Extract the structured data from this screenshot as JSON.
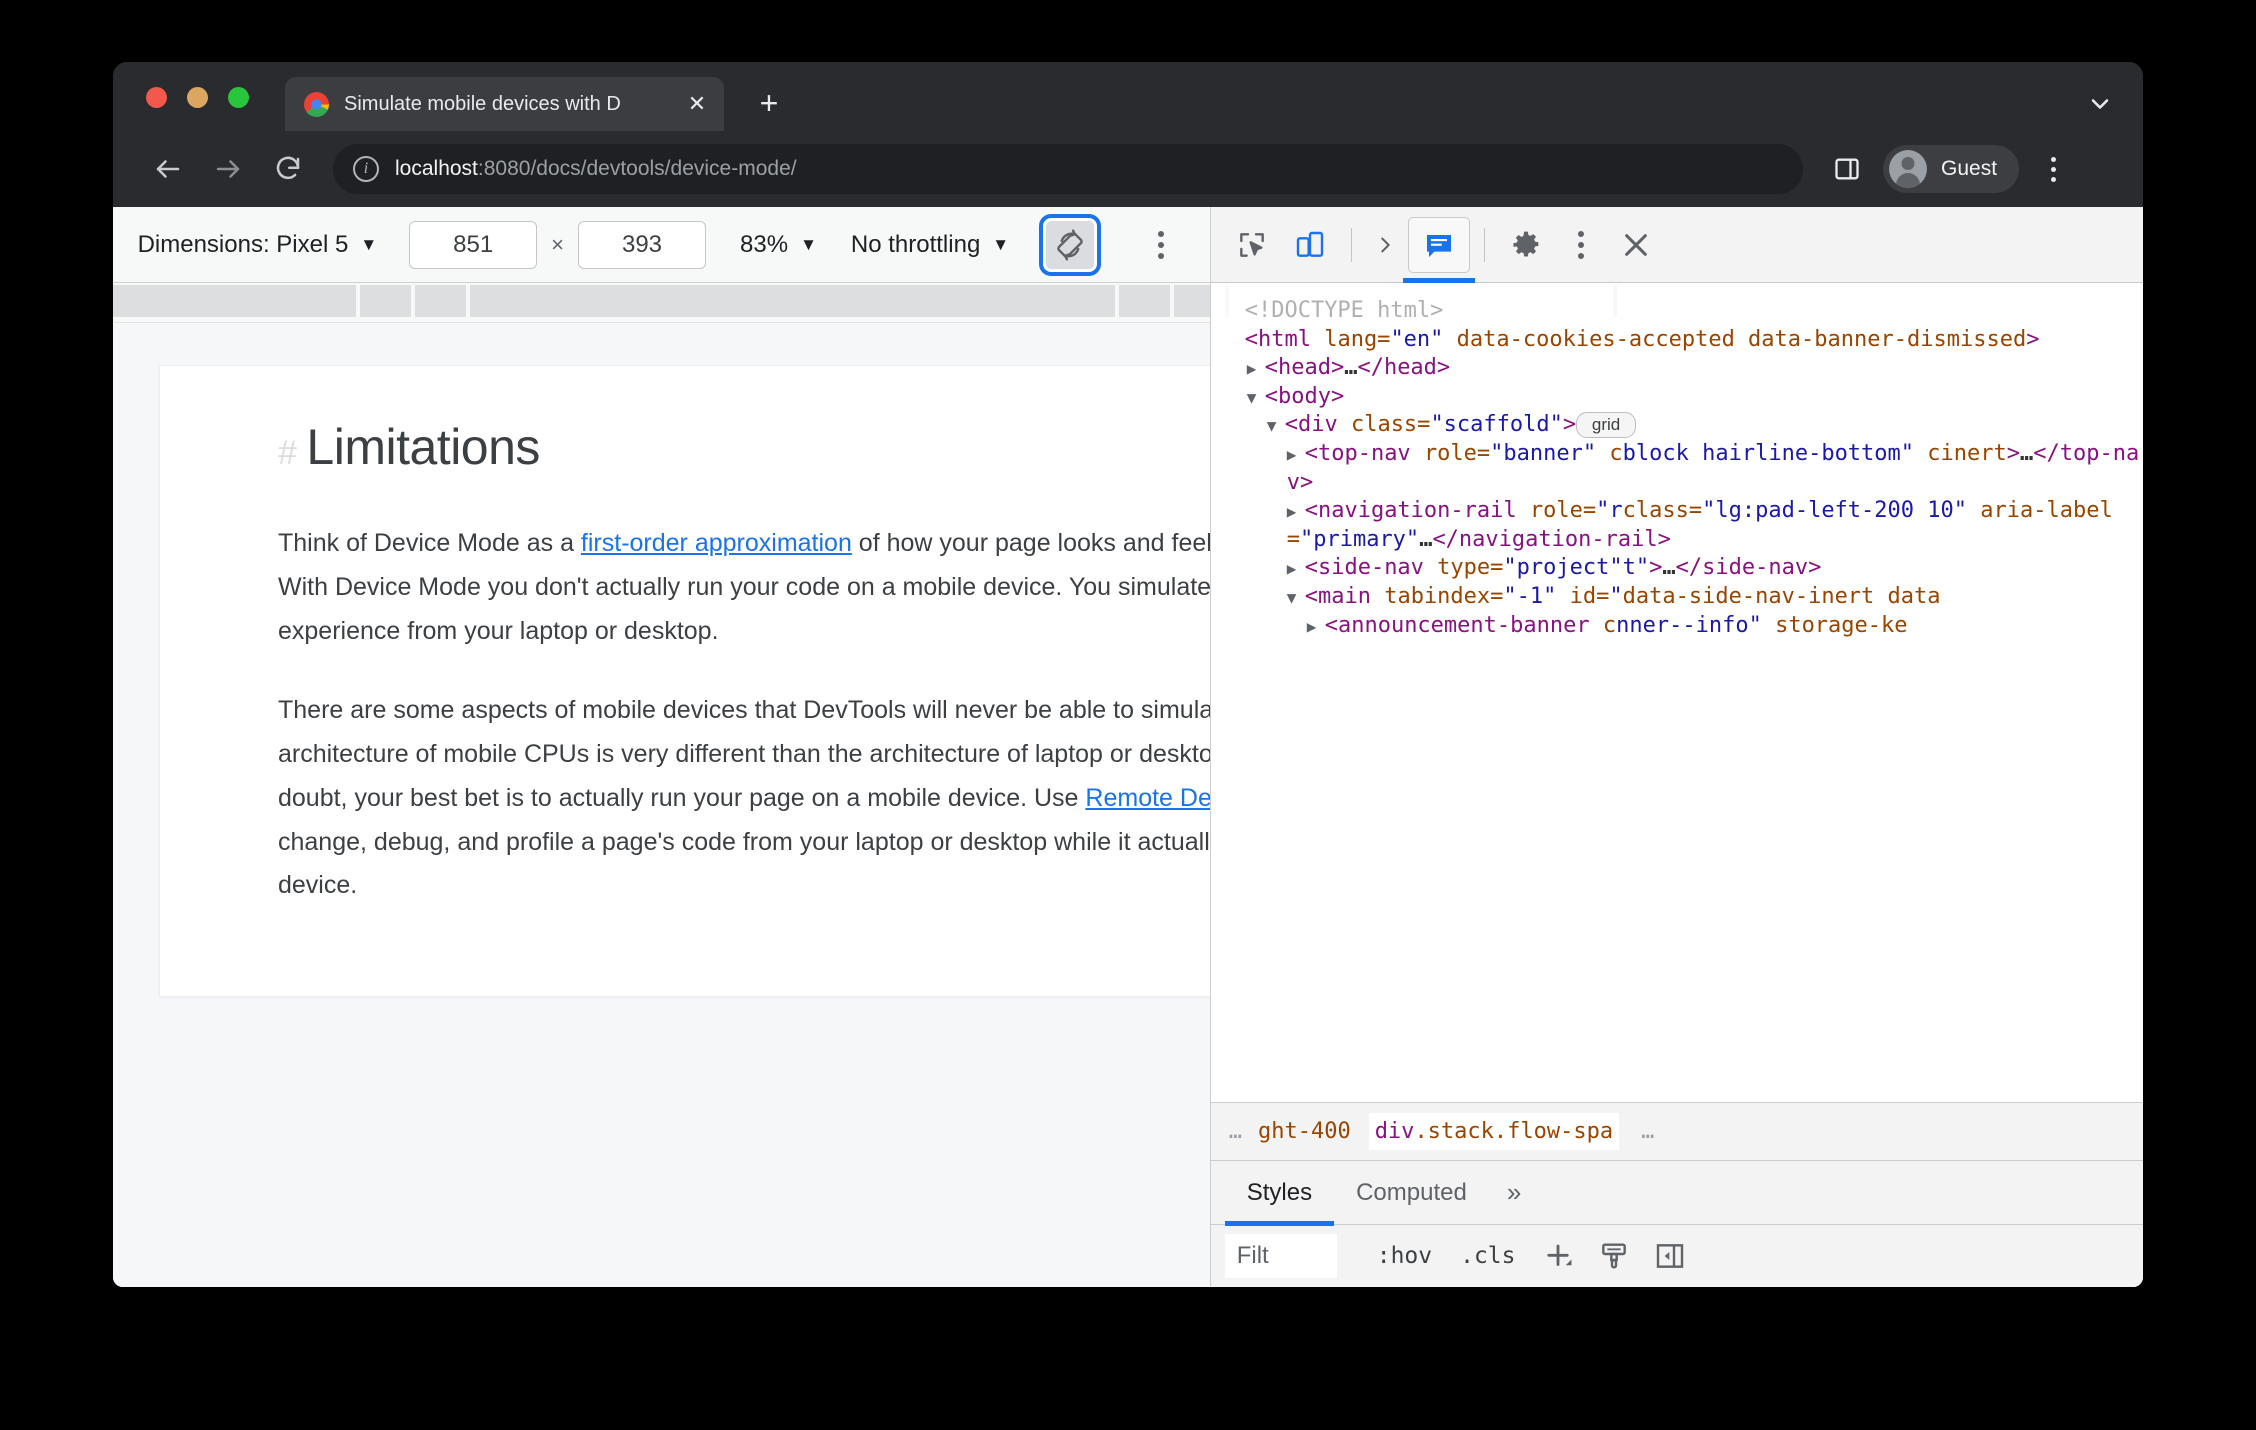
{
  "browser": {
    "tab": {
      "title": "Simulate mobile devices with D",
      "close_label": "✕"
    },
    "new_tab_label": "+",
    "url": {
      "host": "localhost",
      "rest": ":8080/docs/devtools/device-mode/"
    },
    "profile_label": "Guest",
    "icons": {
      "back": "back-arrow-icon",
      "forward": "forward-arrow-icon",
      "reload": "reload-icon",
      "info": "site-info-icon",
      "side_panel": "side-panel-icon",
      "tab_search": "chevron-down-icon",
      "menu": "kebab-menu-icon"
    }
  },
  "device_toolbar": {
    "dimensions_label": "Dimensions: Pixel 5",
    "width": "851",
    "height": "393",
    "times": "×",
    "zoom": "83%",
    "throttling": "No throttling",
    "rotate_icon": "rotate-device-icon",
    "more_icon": "kebab-menu-icon",
    "caret": "▼",
    "accent_focus_color": "#1a73e8"
  },
  "page": {
    "heading": "Limitations",
    "anchor": "#",
    "paragraphs": [
      {
        "before": "Think of Device Mode as a ",
        "link": "first-order approximation",
        "after": " of how your page looks and feels on a mobile device. With Device Mode you don't actually run your code on a mobile device. You simulate the mobile user experience from your laptop or desktop."
      },
      {
        "before": "There are some aspects of mobile devices that DevTools will never be able to simulate. For example, the architecture of mobile CPUs is very different than the architecture of laptop or desktop CPUs. When in doubt, your best bet is to actually run your page on a mobile device. Use ",
        "link": "Remote Debugging",
        "after": " to view, change, debug, and profile a page's code from your laptop or desktop while it actually runs on a mobile device."
      }
    ],
    "link_color": "#1a73e8"
  },
  "devtools": {
    "header_icons": {
      "inspect": "inspect-element-icon",
      "device_toggle": "toggle-device-toolbar-icon",
      "overflow_chevron": "chevron-right-icon",
      "elements_tab": "elements-panel-icon",
      "settings": "gear-icon",
      "more": "kebab-menu-icon",
      "close": "close-icon"
    },
    "active_tab_accent": "#1a73e8",
    "dom_lines": [
      {
        "indent": 0,
        "arrow": "",
        "tokens": [
          {
            "t": "doctype",
            "s": "<!DOCTYPE html>"
          }
        ]
      },
      {
        "indent": 0,
        "arrow": "",
        "tokens": [
          {
            "t": "tag",
            "s": "<html "
          },
          {
            "t": "attr",
            "s": "lang="
          },
          {
            "t": "val",
            "s": "\"en\""
          },
          {
            "t": "attr",
            "s": " data-cookies-accepted data-banner-dismissed"
          },
          {
            "t": "tag",
            "s": ">"
          }
        ]
      },
      {
        "indent": 1,
        "arrow": "▶",
        "tokens": [
          {
            "t": "tag",
            "s": "<head>"
          },
          {
            "t": "ellip",
            "s": "…"
          },
          {
            "t": "tag",
            "s": "</head>"
          }
        ]
      },
      {
        "indent": 1,
        "arrow": "▼",
        "tokens": [
          {
            "t": "tag",
            "s": "<body>"
          }
        ]
      },
      {
        "indent": 2,
        "arrow": "▼",
        "tokens": [
          {
            "t": "tag",
            "s": "<div "
          },
          {
            "t": "attr",
            "s": "class="
          },
          {
            "t": "val",
            "s": "\"scaffold\""
          },
          {
            "t": "tag",
            "s": ">"
          },
          {
            "t": "badge",
            "s": "grid"
          }
        ]
      },
      {
        "indent": 3,
        "arrow": "▶",
        "tokens": [
          {
            "t": "tag",
            "s": "<top-nav "
          },
          {
            "t": "attr",
            "s": "role="
          },
          {
            "t": "val",
            "s": "\"banner\""
          },
          {
            "t": "attr",
            "s": " c"
          },
          {
            "t": "val",
            "s": "block hairline-bottom\""
          },
          {
            "t": "attr",
            "s": " c"
          },
          {
            "t": "attr",
            "s": "inert"
          },
          {
            "t": "tag",
            "s": ">"
          },
          {
            "t": "ellip",
            "s": "…"
          },
          {
            "t": "tag",
            "s": "</top-nav>"
          }
        ]
      },
      {
        "indent": 3,
        "arrow": "▶",
        "tokens": [
          {
            "t": "tag",
            "s": "<navigation-rail "
          },
          {
            "t": "attr",
            "s": "role="
          },
          {
            "t": "val",
            "s": "\"r"
          },
          {
            "t": "attr",
            "s": "class="
          },
          {
            "t": "val",
            "s": "\"lg:pad-left-200 1"
          },
          {
            "t": "val",
            "s": "0\""
          },
          {
            "t": "attr",
            "s": " aria-label="
          },
          {
            "t": "val",
            "s": "\"primary\""
          },
          {
            "t": "ellip",
            "s": "…"
          },
          {
            "t": "tag",
            "s": "</navigation-rail>"
          }
        ]
      },
      {
        "indent": 3,
        "arrow": "▶",
        "tokens": [
          {
            "t": "tag",
            "s": "<side-nav "
          },
          {
            "t": "attr",
            "s": "type="
          },
          {
            "t": "val",
            "s": "\"project\""
          },
          {
            "t": "val",
            "s": "t\""
          },
          {
            "t": "tag",
            "s": ">"
          },
          {
            "t": "ellip",
            "s": "…"
          },
          {
            "t": "tag",
            "s": "</side-nav>"
          }
        ]
      },
      {
        "indent": 3,
        "arrow": "▼",
        "tokens": [
          {
            "t": "tag",
            "s": "<main "
          },
          {
            "t": "attr",
            "s": "tabindex="
          },
          {
            "t": "val",
            "s": "\"-1\""
          },
          {
            "t": "attr",
            "s": " id="
          },
          {
            "t": "val",
            "s": "\""
          },
          {
            "t": "attr",
            "s": "data-side-nav-inert data"
          }
        ]
      },
      {
        "indent": 4,
        "arrow": "▶",
        "tokens": [
          {
            "t": "tag",
            "s": "<announcement-banner "
          },
          {
            "t": "attr",
            "s": "c"
          },
          {
            "t": "val",
            "s": "nner--info\""
          },
          {
            "t": "attr",
            "s": " storage-ke"
          }
        ]
      }
    ],
    "breadcrumb": {
      "left_ellipsis": "…",
      "crumb_partial": "ght-400",
      "crumb_selected_tag": "div",
      "crumb_selected_classes": ".stack.flow-spa",
      "right_ellipsis": "…"
    },
    "styles": {
      "tabs": [
        {
          "label": "Styles",
          "active": true
        },
        {
          "label": "Computed",
          "active": false
        }
      ],
      "more_label": "»",
      "filter_value": "Filt",
      "filter_placeholder": "Filter",
      "hov_label": ":hov",
      "cls_label": ".cls",
      "new_rule_icon": "plus-icon",
      "element_style_icon": "paintbrush-icon",
      "sidebar_toggle_icon": "toggle-sidebar-icon"
    }
  }
}
